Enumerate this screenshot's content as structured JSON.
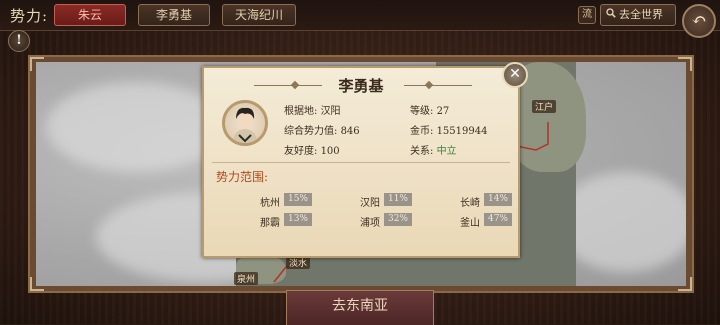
{
  "header": {
    "faction_label": "势力:",
    "tabs": [
      {
        "label": "朱云",
        "active": true
      },
      {
        "label": "李勇基",
        "active": false
      },
      {
        "label": "天海纪川",
        "active": false
      }
    ],
    "stream_label": "流",
    "world_label": "去全世界",
    "back_icon": "back-arrow-icon",
    "alert_icon": "exclamation-icon"
  },
  "map": {
    "cities": [
      "江户",
      "淡水",
      "泉州"
    ]
  },
  "bottom_button": {
    "label": "去东南亚"
  },
  "popup": {
    "name": "李勇基",
    "base_label": "根据地:",
    "base_value": "汉阳",
    "level_label": "等级:",
    "level_value": "27",
    "power_label": "综合势力值:",
    "power_value": "846",
    "gold_label": "金币:",
    "gold_value": "15519944",
    "favor_label": "友好度:",
    "favor_value": "100",
    "relation_label": "关系:",
    "relation_value": "中立",
    "range_title": "势力范围:",
    "regions": [
      {
        "name": "杭州",
        "pct": "15%"
      },
      {
        "name": "汉阳",
        "pct": "11%"
      },
      {
        "name": "长崎",
        "pct": "14%"
      },
      {
        "name": "那霸",
        "pct": "13%"
      },
      {
        "name": "浦项",
        "pct": "32%"
      },
      {
        "name": "釜山",
        "pct": "47%"
      }
    ],
    "close_icon": "close-icon"
  },
  "colors": {
    "accent_red": "#8a2a24",
    "relation_green": "#2e8a3a",
    "range_title": "#b24a1f"
  }
}
